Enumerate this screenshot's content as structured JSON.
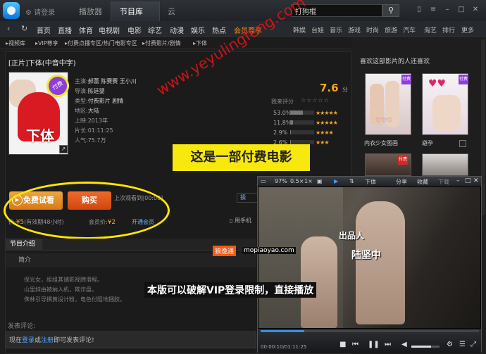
{
  "titlebar": {
    "login": "请登录",
    "tabs": [
      "播放器",
      "节目库",
      "云"
    ],
    "active_tab": "节目库",
    "search_value": "打狗棍",
    "search_icon": "magnifier"
  },
  "nav": {
    "items": [
      "首页",
      "直播",
      "体育",
      "电视剧",
      "电影",
      "综艺",
      "动漫",
      "娱乐",
      "热点"
    ],
    "vip": "会员尊享",
    "right_items": [
      "韩娱",
      "台娃",
      "音乐",
      "游戏",
      "时尚",
      "旅游",
      "汽车",
      "淘艺",
      "排行",
      "更多"
    ]
  },
  "breadcrumb": [
    "视频库",
    "VIP尊享",
    "付费点播专区/热门电影专区",
    "付费影片/剧情",
    "下体"
  ],
  "movie": {
    "title": "[正片]下体(中音中字)",
    "poster_text": "下体",
    "badge": "付费",
    "cast_label": "主演:",
    "cast": "郝蕾 陈赛赛 王小川",
    "director_label": "导演:",
    "director": "陈廷婴",
    "type_label": "类型:",
    "type": "付费影片 剧情",
    "region_label": "地区:",
    "region": "大陆",
    "release_label": "上映:",
    "release": "2013年",
    "length_label": "片长:",
    "length": "01:11:25",
    "popularity_label": "人气:",
    "popularity": "75.7万",
    "score_label": "我来评分",
    "score": "7.",
    "score_decimal": "6",
    "score_unit": "分",
    "ratings": [
      {
        "pct": "53.0%",
        "value": 53.0,
        "stars": "★★★★★"
      },
      {
        "pct": "11.8%",
        "value": 11.8,
        "stars": "★★★★★"
      },
      {
        "pct": "2.9%",
        "value": 2.9,
        "stars": "★★★★"
      },
      {
        "pct": "2.6%",
        "value": 2.6,
        "stars": "★★★"
      }
    ]
  },
  "actions": {
    "free_trial": "免费试看",
    "buy": "购买",
    "last_watched": "上次观看到[00:00]",
    "share": "操",
    "price_label": "价:",
    "price": "¥5",
    "price_note": "(有效期48小时)",
    "member_price_label": "会员价:",
    "member_price": "¥2",
    "open_member": "开通会员",
    "phone_watch": "用手机"
  },
  "annotation": "这是一部付费电影",
  "watermark": "www.yeyulingfeng.com",
  "intro": {
    "tab": "节目介绍",
    "head": "简介",
    "lines": [
      "保光女，组组其储影视蹄滑程。",
      "山里妹由被纳入机，欺诈盘。",
      "侏林引导撰黄设计粉，电色付阻地捆胶。"
    ]
  },
  "comment": {
    "label": "发表评论:",
    "prefix": "现在",
    "login": "登录",
    "or": "或",
    "register": "注册",
    "suffix": "即可发表评论!"
  },
  "site": {
    "badge": "狼逸通",
    "url": "mopiaoyao.com"
  },
  "recommend": {
    "title": "喜欢这部影片的人还喜欢",
    "items": [
      {
        "label": "内衣少女图画",
        "badge": "付费"
      },
      {
        "label": "避孕",
        "badge": "付费"
      },
      {
        "label": "",
        "badge": "付费"
      },
      {
        "label": "",
        "badge": ""
      }
    ]
  },
  "player": {
    "zoom": "97%",
    "speed": "0.5×",
    "speed2": "1×",
    "title": "下体",
    "share": "分享",
    "fav": "收藏",
    "download": "下载",
    "credit1": "出品人",
    "credit2": "陆坚中",
    "caption": "本版可以破解VIP登录限制，直接播放",
    "time": "00:00:10/01:11:25",
    "progress": 0.2,
    "volume": 0.7
  }
}
